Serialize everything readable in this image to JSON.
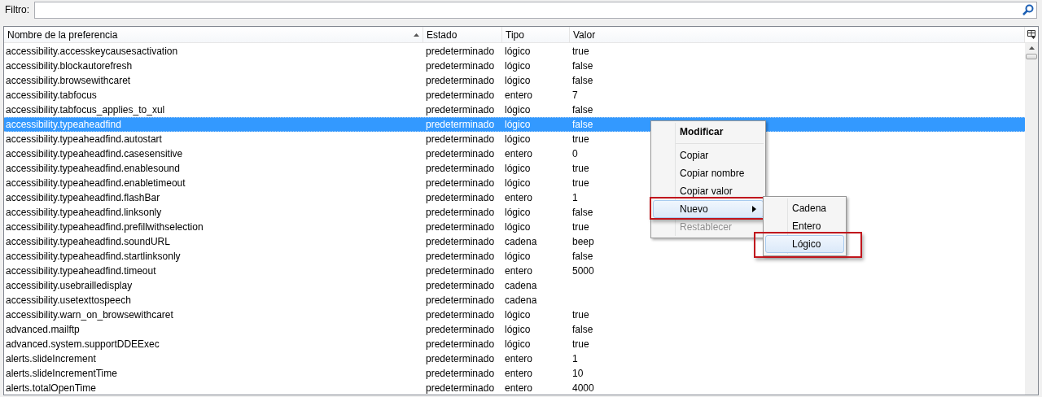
{
  "filter": {
    "label": "Filtro:"
  },
  "table": {
    "columns": [
      {
        "label": "Nombre de la preferencia",
        "sorted": true
      },
      {
        "label": "Estado",
        "sorted": false
      },
      {
        "label": "Tipo",
        "sorted": false
      },
      {
        "label": "Valor",
        "sorted": false
      }
    ],
    "rows": [
      {
        "name": "accessibility.accesskeycausesactivation",
        "state": "predeterminado",
        "type": "lógico",
        "value": "true",
        "selected": false
      },
      {
        "name": "accessibility.blockautorefresh",
        "state": "predeterminado",
        "type": "lógico",
        "value": "false",
        "selected": false
      },
      {
        "name": "accessibility.browsewithcaret",
        "state": "predeterminado",
        "type": "lógico",
        "value": "false",
        "selected": false
      },
      {
        "name": "accessibility.tabfocus",
        "state": "predeterminado",
        "type": "entero",
        "value": "7",
        "selected": false
      },
      {
        "name": "accessibility.tabfocus_applies_to_xul",
        "state": "predeterminado",
        "type": "lógico",
        "value": "false",
        "selected": false
      },
      {
        "name": "accessibility.typeaheadfind",
        "state": "predeterminado",
        "type": "lógico",
        "value": "false",
        "selected": true
      },
      {
        "name": "accessibility.typeaheadfind.autostart",
        "state": "predeterminado",
        "type": "lógico",
        "value": "true",
        "selected": false
      },
      {
        "name": "accessibility.typeaheadfind.casesensitive",
        "state": "predeterminado",
        "type": "entero",
        "value": "0",
        "selected": false
      },
      {
        "name": "accessibility.typeaheadfind.enablesound",
        "state": "predeterminado",
        "type": "lógico",
        "value": "true",
        "selected": false
      },
      {
        "name": "accessibility.typeaheadfind.enabletimeout",
        "state": "predeterminado",
        "type": "lógico",
        "value": "true",
        "selected": false
      },
      {
        "name": "accessibility.typeaheadfind.flashBar",
        "state": "predeterminado",
        "type": "entero",
        "value": "1",
        "selected": false
      },
      {
        "name": "accessibility.typeaheadfind.linksonly",
        "state": "predeterminado",
        "type": "lógico",
        "value": "false",
        "selected": false
      },
      {
        "name": "accessibility.typeaheadfind.prefillwithselection",
        "state": "predeterminado",
        "type": "lógico",
        "value": "true",
        "selected": false
      },
      {
        "name": "accessibility.typeaheadfind.soundURL",
        "state": "predeterminado",
        "type": "cadena",
        "value": "beep",
        "selected": false
      },
      {
        "name": "accessibility.typeaheadfind.startlinksonly",
        "state": "predeterminado",
        "type": "lógico",
        "value": "false",
        "selected": false
      },
      {
        "name": "accessibility.typeaheadfind.timeout",
        "state": "predeterminado",
        "type": "entero",
        "value": "5000",
        "selected": false
      },
      {
        "name": "accessibility.usebrailledisplay",
        "state": "predeterminado",
        "type": "cadena",
        "selected": false
      },
      {
        "name": "accessibility.usetexttospeech",
        "state": "predeterminado",
        "type": "cadena",
        "selected": false
      },
      {
        "name": "accessibility.warn_on_browsewithcaret",
        "state": "predeterminado",
        "type": "lógico",
        "value": "true",
        "selected": false
      },
      {
        "name": "advanced.mailftp",
        "state": "predeterminado",
        "type": "lógico",
        "value": "false",
        "selected": false
      },
      {
        "name": "advanced.system.supportDDEExec",
        "state": "predeterminado",
        "type": "lógico",
        "value": "true",
        "selected": false
      },
      {
        "name": "alerts.slideIncrement",
        "state": "predeterminado",
        "type": "entero",
        "value": "1",
        "selected": false
      },
      {
        "name": "alerts.slideIncrementTime",
        "state": "predeterminado",
        "type": "entero",
        "value": "10",
        "selected": false
      },
      {
        "name": "alerts.totalOpenTime",
        "state": "predeterminado",
        "type": "entero",
        "value": "4000",
        "selected": false
      }
    ]
  },
  "context_menu": {
    "items": [
      {
        "kind": "item",
        "label": "Modificar",
        "bold": true,
        "disabled": false,
        "selected": false,
        "annotated": false
      },
      {
        "kind": "separator"
      },
      {
        "kind": "item",
        "label": "Copiar",
        "bold": false,
        "disabled": false,
        "selected": false,
        "annotated": false
      },
      {
        "kind": "item",
        "label": "Copiar nombre",
        "bold": false,
        "disabled": false,
        "selected": false,
        "annotated": false
      },
      {
        "kind": "item",
        "label": "Copiar valor",
        "bold": false,
        "disabled": false,
        "selected": false,
        "annotated": false
      },
      {
        "kind": "submenu",
        "label": "Nuevo",
        "bold": false,
        "disabled": false,
        "selected": true,
        "annotated": true
      },
      {
        "kind": "item",
        "label": "Restablecer",
        "bold": false,
        "disabled": true,
        "selected": false,
        "annotated": false
      }
    ]
  },
  "submenu": {
    "items": [
      {
        "label": "Cadena",
        "selected": false,
        "annotated": false
      },
      {
        "label": "Entero",
        "selected": false,
        "annotated": false
      },
      {
        "label": "Lógico",
        "selected": true,
        "annotated": true
      }
    ]
  }
}
